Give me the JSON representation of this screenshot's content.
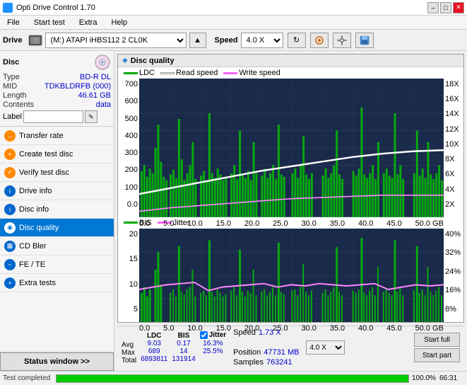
{
  "titleBar": {
    "title": "Opti Drive Control 1.70",
    "minimize": "–",
    "maximize": "□",
    "close": "✕"
  },
  "menuBar": {
    "items": [
      "File",
      "Start test",
      "Extra",
      "Help"
    ]
  },
  "driveBar": {
    "driveLabel": "Drive",
    "driveValue": "(M:)  ATAPI iHBS112  2 CL0K",
    "speedLabel": "Speed",
    "speedValue": "4.0 X"
  },
  "disc": {
    "title": "Disc",
    "type": {
      "label": "Type",
      "value": "BD-R DL"
    },
    "mid": {
      "label": "MID",
      "value": "TDKBLDRFB (000)"
    },
    "length": {
      "label": "Length",
      "value": "46.61 GB"
    },
    "contents": {
      "label": "Contents",
      "value": "data"
    },
    "labelField": {
      "label": "Label",
      "value": ""
    }
  },
  "navItems": [
    {
      "id": "transfer-rate",
      "label": "Transfer rate",
      "iconType": "orange"
    },
    {
      "id": "create-test-disc",
      "label": "Create test disc",
      "iconType": "orange"
    },
    {
      "id": "verify-test-disc",
      "label": "Verify test disc",
      "iconType": "orange"
    },
    {
      "id": "drive-info",
      "label": "Drive info",
      "iconType": "blue"
    },
    {
      "id": "disc-info",
      "label": "Disc info",
      "iconType": "blue"
    },
    {
      "id": "disc-quality",
      "label": "Disc quality",
      "iconType": "cyan",
      "active": true
    },
    {
      "id": "cd-bler",
      "label": "CD Bler",
      "iconType": "blue"
    },
    {
      "id": "fe-te",
      "label": "FE / TE",
      "iconType": "blue"
    },
    {
      "id": "extra-tests",
      "label": "Extra tests",
      "iconType": "blue"
    }
  ],
  "statusBtn": "Status window >>",
  "chartTitle": "Disc quality",
  "topChart": {
    "legend": [
      {
        "label": "LDC",
        "color": "#00aa00"
      },
      {
        "label": "Read speed",
        "color": "#ffffff"
      },
      {
        "label": "Write speed",
        "color": "#ff66ff"
      }
    ],
    "yAxisLeft": [
      "700",
      "600",
      "500",
      "400",
      "300",
      "200",
      "100",
      "0.0"
    ],
    "yAxisRight": [
      "18X",
      "16X",
      "14X",
      "12X",
      "10X",
      "8X",
      "6X",
      "4X",
      "2X"
    ],
    "xAxisLabels": [
      "0.0",
      "5.0",
      "10.0",
      "15.0",
      "20.0",
      "25.0",
      "30.0",
      "35.0",
      "40.0",
      "45.0",
      "50.0 GB"
    ]
  },
  "bottomChart": {
    "legend": [
      {
        "label": "BIS",
        "color": "#00aa00"
      },
      {
        "label": "Jitter",
        "color": "#ff66ff"
      }
    ],
    "yAxisLeft": [
      "20",
      "15",
      "10",
      "5"
    ],
    "yAxisRight": [
      "40%",
      "32%",
      "24%",
      "16%",
      "8%"
    ],
    "xAxisLabels": [
      "0.0",
      "5.0",
      "10.0",
      "15.0",
      "20.0",
      "25.0",
      "30.0",
      "35.0",
      "40.0",
      "45.0",
      "50.0 GB"
    ]
  },
  "stats": {
    "avgLabel": "Avg",
    "maxLabel": "Max",
    "totalLabel": "Total",
    "ldcHeader": "LDC",
    "bisHeader": "BIS",
    "jitterHeader": "Jitter",
    "speedHeader": "Speed",
    "positionHeader": "Position",
    "samplesHeader": "Samples",
    "ldcAvg": "9.03",
    "ldcMax": "689",
    "ldcTotal": "6893811",
    "bisAvg": "0.17",
    "bisMax": "14",
    "bisTotal": "131914",
    "jitterChecked": true,
    "jitterAvg": "16.3%",
    "jitterMax": "25.5%",
    "speedVal": "1.73 X",
    "speedDropdown": "4.0 X",
    "positionVal": "47731 MB",
    "samplesVal": "763241",
    "startFull": "Start full",
    "startPart": "Start part"
  },
  "progress": {
    "statusText": "Test completed",
    "percent": "100.0%",
    "percentNum": 100,
    "timeVal": "66:31"
  }
}
